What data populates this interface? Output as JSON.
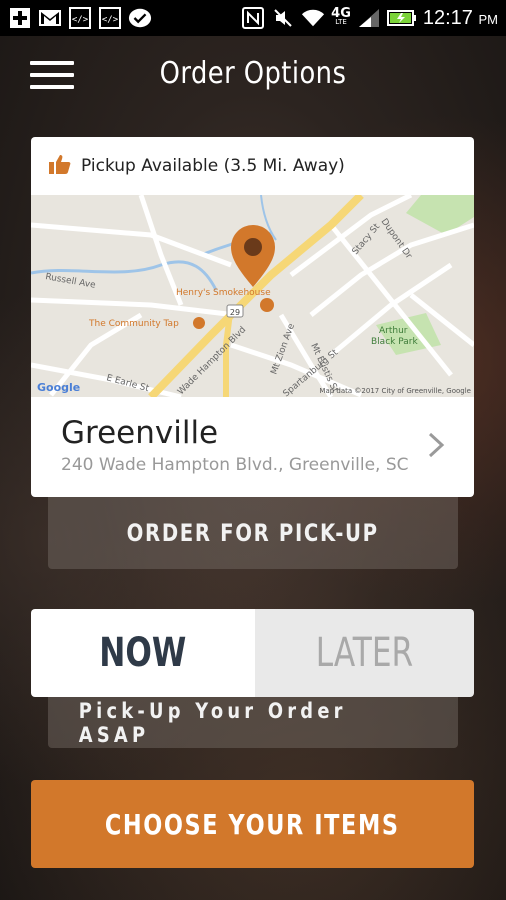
{
  "status_bar": {
    "time": "12:17",
    "ampm": "PM",
    "network": "4G",
    "network_sub": "LTE"
  },
  "header": {
    "title": "Order Options"
  },
  "location_card": {
    "pickup_text": "Pickup Available (3.5 Mi. Away)",
    "map": {
      "places": [
        "Henry's Smokehouse",
        "The Community Tap",
        "Arthur Black Park"
      ],
      "streets": [
        "Russell Ave",
        "Wade Hampton Blvd",
        "Dupont Dr",
        "Stacy St",
        "Mt Zion Ave",
        "Mt Eustis St",
        "Spartanburg St",
        "E Earle St"
      ],
      "route_badge": "29",
      "attribution": "Map data ©2017 City of Greenville, Google",
      "logo": "Google"
    },
    "name": "Greenville",
    "address": "240 Wade Hampton Blvd., Greenville, SC"
  },
  "buttons": {
    "order_pickup": "ORDER FOR PICK-UP",
    "now": "NOW",
    "later": "LATER",
    "asap_text": "Pick-Up Your Order ASAP",
    "choose_items": "CHOOSE YOUR ITEMS"
  },
  "colors": {
    "accent": "#d2782b",
    "now_text": "#2f3a48"
  },
  "icons": [
    "plus-icon",
    "gmail-icon",
    "code-icon",
    "code-icon",
    "check-icon",
    "nfc-icon",
    "mute-icon",
    "wifi-icon",
    "signal-icon",
    "battery-icon",
    "menu-icon",
    "thumbs-up-icon",
    "map-pin-icon",
    "chevron-right-icon"
  ]
}
